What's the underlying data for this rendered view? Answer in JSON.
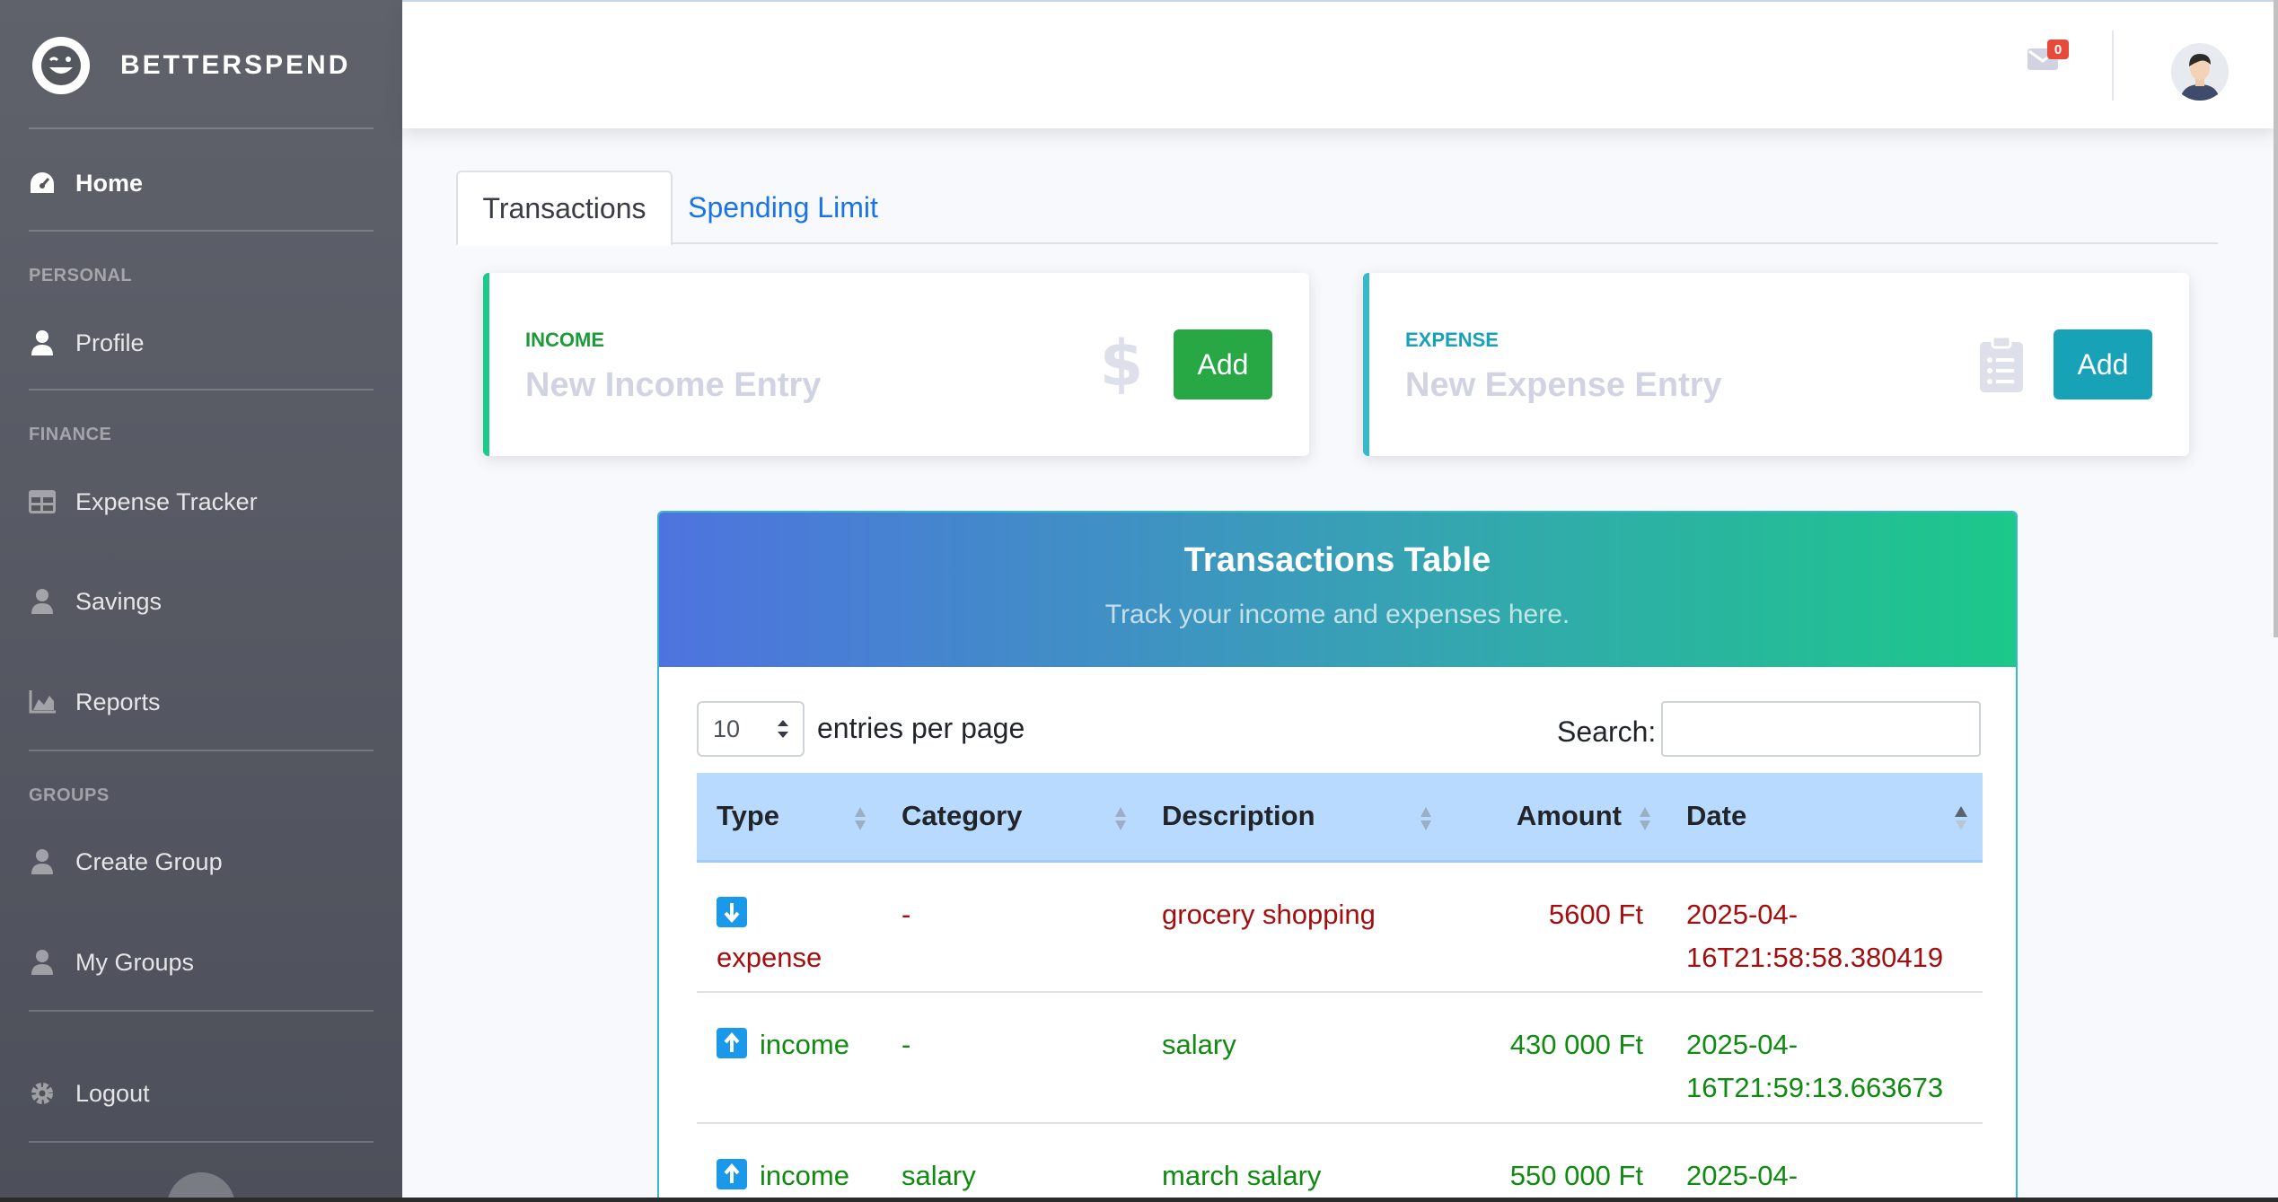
{
  "brand": {
    "name": "BETTERSPEND",
    "logo_icon": "wink-face-icon"
  },
  "sidebar": {
    "home": {
      "label": "Home",
      "icon": "speedometer-icon"
    },
    "sections": [
      {
        "heading": "PERSONAL"
      },
      {
        "heading": "FINANCE"
      },
      {
        "heading": "GROUPS"
      }
    ],
    "items": [
      {
        "label": "Profile",
        "icon": "user-icon"
      },
      {
        "label": "Expense Tracker",
        "icon": "table-icon"
      },
      {
        "label": "Savings",
        "icon": "user-icon"
      },
      {
        "label": "Reports",
        "icon": "area-chart-icon"
      },
      {
        "label": "Create Group",
        "icon": "user-icon"
      },
      {
        "label": "My Groups",
        "icon": "user-icon"
      },
      {
        "label": "Logout",
        "icon": "gear-icon"
      }
    ]
  },
  "topbar": {
    "mail_count": "0"
  },
  "tabs": [
    {
      "label": "Transactions",
      "active": true
    },
    {
      "label": "Spending Limit",
      "active": false
    }
  ],
  "income_card": {
    "label": "INCOME",
    "placeholder": "New Income Entry",
    "button": "Add",
    "accent": "#1cc88a"
  },
  "expense_card": {
    "label": "EXPENSE",
    "placeholder": "New Expense Entry",
    "button": "Add",
    "accent": "#36b9cc"
  },
  "transactions": {
    "title": "Transactions Table",
    "subtitle": "Track your income and expenses here.",
    "page_size": "10",
    "entries_label": "entries per page",
    "search_label": "Search:",
    "search_value": "",
    "columns": [
      "Type",
      "Category",
      "Description",
      "Amount",
      "Date"
    ],
    "rows": [
      {
        "type": "expense",
        "category": "-",
        "description": "grocery shopping",
        "amount": "5600 Ft",
        "date": "2025-04-16T21:58:58.380419"
      },
      {
        "type": "income",
        "category": "-",
        "description": "salary",
        "amount": "430 000 Ft",
        "date": "2025-04-16T21:59:13.663673"
      },
      {
        "type": "income",
        "category": "salary",
        "description": "march salary",
        "amount": "550 000 Ft",
        "date": "2025-04-"
      }
    ],
    "colors": {
      "expense": "#a50e0e",
      "income": "#108a10",
      "header_bg": "#b8daff"
    }
  }
}
